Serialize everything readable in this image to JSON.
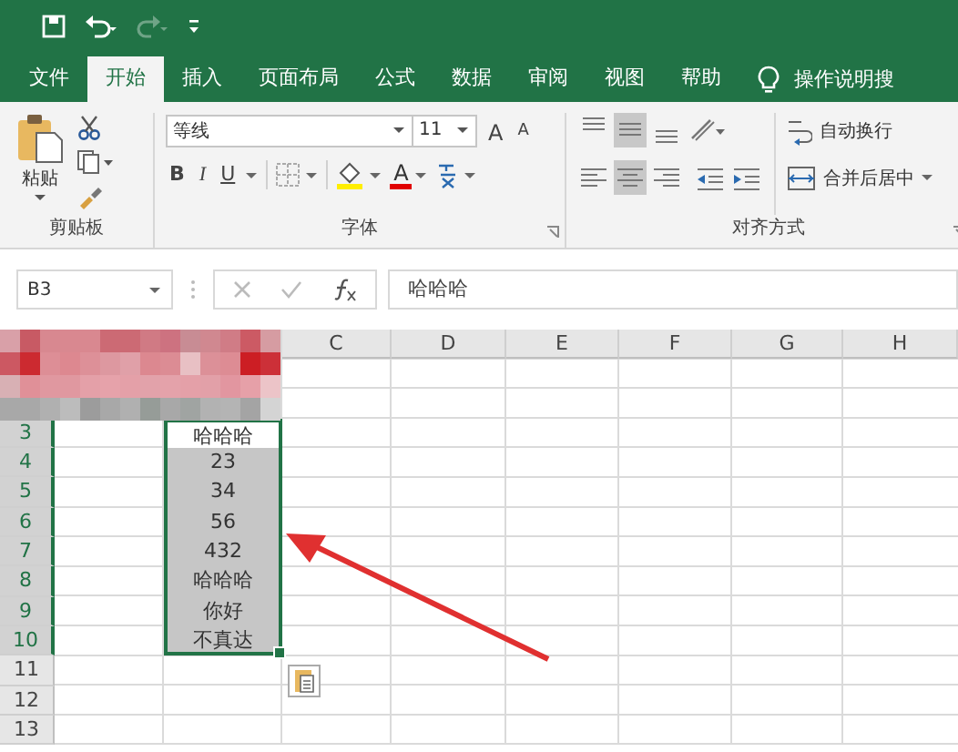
{
  "quick_access": [
    {
      "kind": "save",
      "disabled": false
    },
    {
      "kind": "undo",
      "disabled": false
    },
    {
      "kind": "redo",
      "disabled": true
    },
    {
      "kind": "customize",
      "disabled": false
    }
  ],
  "tabs": [
    {
      "label": "文件",
      "selected": false
    },
    {
      "label": "开始",
      "selected": true
    },
    {
      "label": "插入",
      "selected": false
    },
    {
      "label": "页面布局",
      "selected": false
    },
    {
      "label": "公式",
      "selected": false
    },
    {
      "label": "数据",
      "selected": false
    },
    {
      "label": "审阅",
      "selected": false
    },
    {
      "label": "视图",
      "selected": false
    },
    {
      "label": "帮助",
      "selected": false
    }
  ],
  "tell_me": "操作说明搜",
  "ribbon": {
    "clipboard": {
      "label": "剪贴板",
      "paste": "粘贴"
    },
    "font": {
      "label": "字体",
      "font_name": "等线",
      "font_size": "11",
      "grow": "A",
      "shrink": "A",
      "bold": "B",
      "italic": "I",
      "underline": "U",
      "font_color": "A"
    },
    "alignment": {
      "label": "对齐方式",
      "wrap_text": "自动换行",
      "merge_center": "合并后居中",
      "vertical": [
        {
          "selected": false
        },
        {
          "selected": true
        },
        {
          "selected": false
        }
      ],
      "horizontal": [
        {
          "selected": false
        },
        {
          "selected": true
        },
        {
          "selected": false
        }
      ]
    }
  },
  "formula_bar": {
    "name_box": "B3",
    "formula": "哈哈哈"
  },
  "sheet": {
    "columns": [
      {
        "label": "C"
      },
      {
        "label": "D"
      },
      {
        "label": "E"
      },
      {
        "label": "F"
      },
      {
        "label": "G"
      },
      {
        "label": "H"
      }
    ],
    "rows": [
      {
        "header": "3",
        "b": "哈哈哈",
        "selected": true
      },
      {
        "header": "4",
        "b": "23",
        "selected": true
      },
      {
        "header": "5",
        "b": "34",
        "selected": true
      },
      {
        "header": "6",
        "b": "56",
        "selected": true
      },
      {
        "header": "7",
        "b": "432",
        "selected": true
      },
      {
        "header": "8",
        "b": "哈哈哈",
        "selected": true
      },
      {
        "header": "9",
        "b": "你好",
        "selected": true
      },
      {
        "header": "10",
        "b": "不真达",
        "selected": true
      },
      {
        "header": "11",
        "selected": false
      },
      {
        "header": "12",
        "selected": false
      },
      {
        "header": "13",
        "selected": false
      }
    ],
    "paste_options_visible": true
  }
}
